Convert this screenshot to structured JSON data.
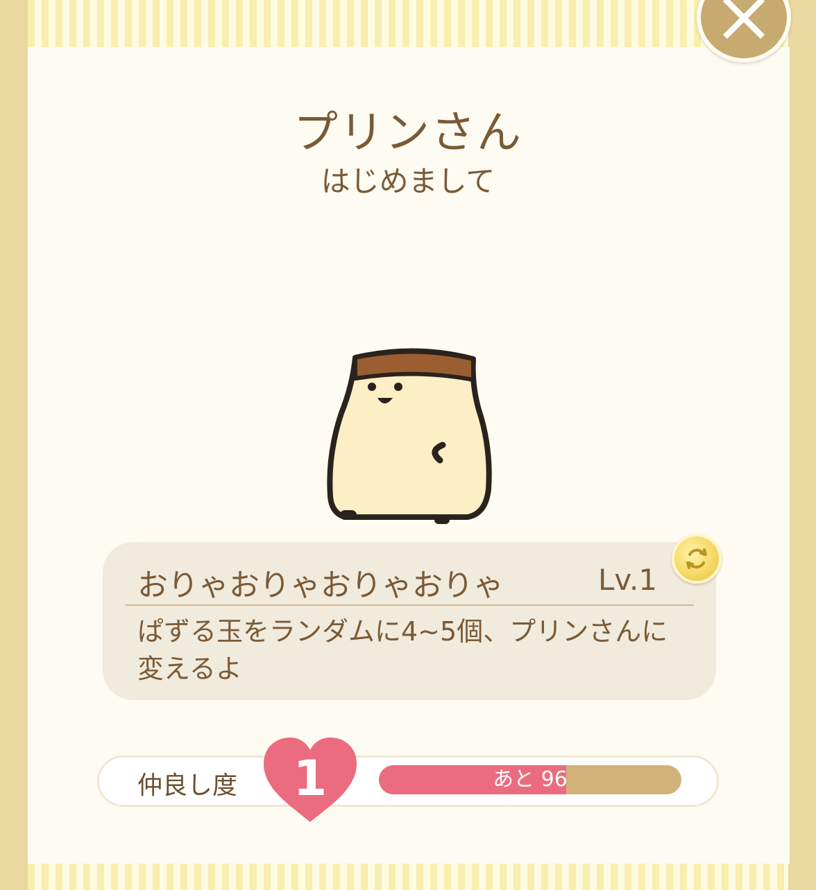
{
  "character": {
    "name": "プリンさん",
    "greeting": "はじめまして"
  },
  "skill": {
    "name": "おりゃおりゃおりゃおりゃ",
    "level": "Lv.1",
    "description": "ぱずる玉をランダムに4~5個、プリンさんに変えるよ"
  },
  "friendship": {
    "label": "仲良し度",
    "level": "1",
    "remaining_text": "あと 96",
    "progress_fraction": 0.62
  },
  "buttons": {
    "close_icon": "close-icon",
    "refresh_icon": "refresh-icon"
  },
  "colors": {
    "text_brown": "#7a5a36",
    "heart_pink": "#eb6c7e",
    "progress_track": "#d2b27a",
    "coin_gold": "#f6d660"
  }
}
